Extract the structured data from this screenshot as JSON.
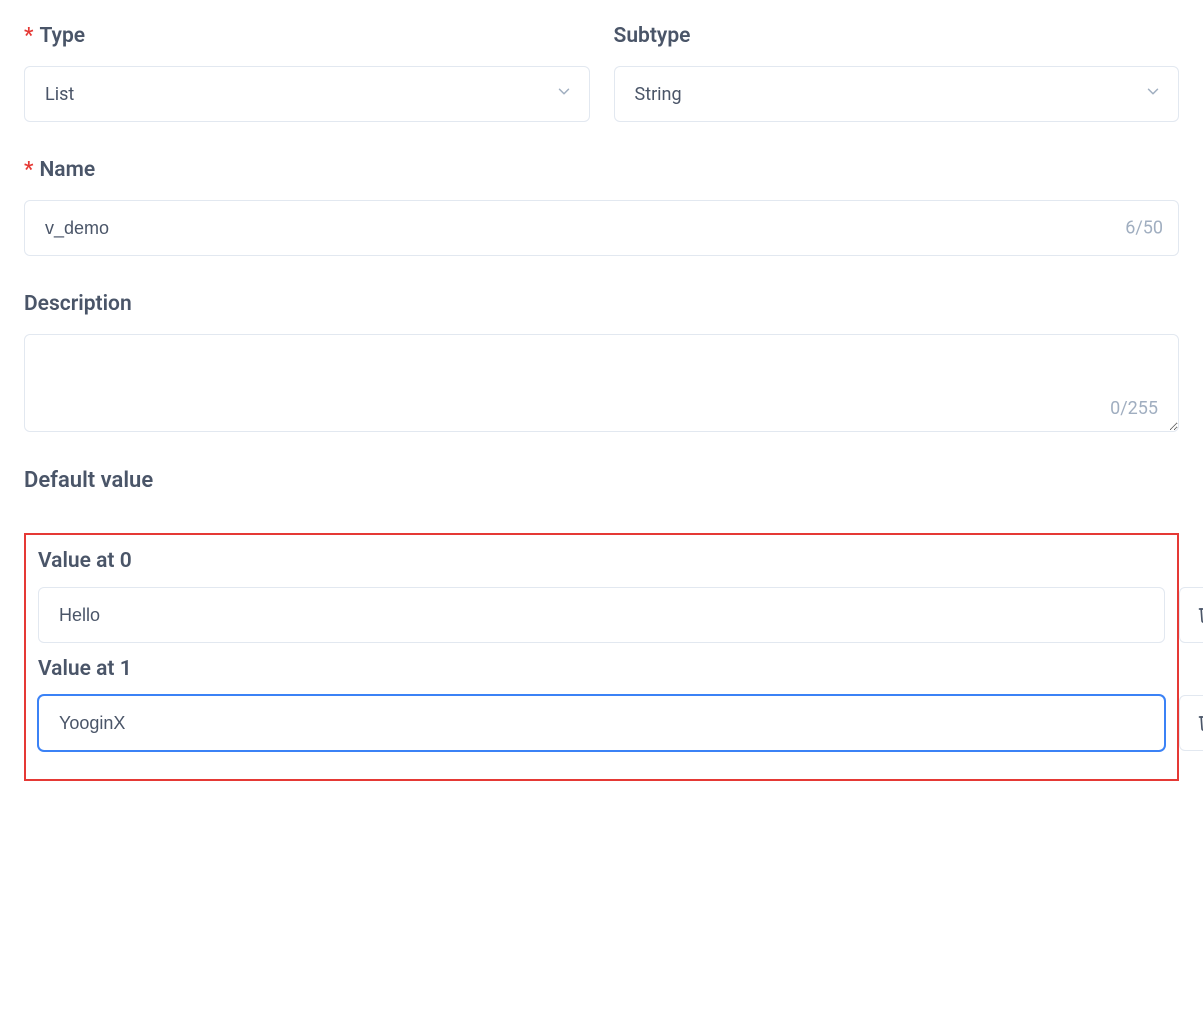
{
  "labels": {
    "type": "Type",
    "subtype": "Subtype",
    "name": "Name",
    "description": "Description",
    "defaultValue": "Default value"
  },
  "required": {
    "type": true,
    "name": true
  },
  "type": {
    "selected": "List"
  },
  "subtype": {
    "selected": "String"
  },
  "name": {
    "value": "v_demo",
    "counter": "6/50"
  },
  "description": {
    "value": "",
    "counter": "0/255"
  },
  "defaultValues": [
    {
      "label": "Value at 0",
      "value": "Hello",
      "focused": false
    },
    {
      "label": "Value at 1",
      "value": "YooginX",
      "focused": true
    }
  ]
}
